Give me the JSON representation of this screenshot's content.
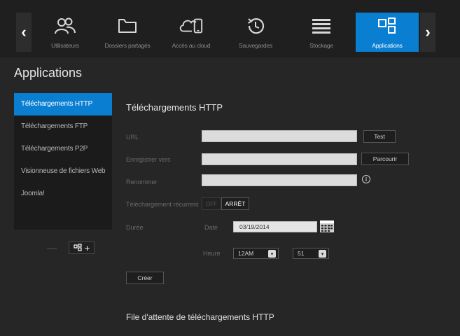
{
  "nav": {
    "items": [
      {
        "label": "Utilisateurs",
        "icon": "users-icon"
      },
      {
        "label": "Dossiers partagés",
        "icon": "folder-icon"
      },
      {
        "label": "Accès au cloud",
        "icon": "cloud-device-icon"
      },
      {
        "label": "Sauvegardes",
        "icon": "history-icon"
      },
      {
        "label": "Stockage",
        "icon": "storage-icon"
      },
      {
        "label": "Applications",
        "icon": "apps-icon",
        "active": true
      }
    ],
    "prev_arrow": "‹",
    "next_arrow": "›"
  },
  "page": {
    "title": "Applications"
  },
  "sidebar": {
    "items": [
      {
        "label": "Téléchargements HTTP",
        "active": true
      },
      {
        "label": "Téléchargements FTP"
      },
      {
        "label": "Téléchargements P2P"
      },
      {
        "label": "Visionneuse de fichiers Web"
      },
      {
        "label": "Joomla!"
      }
    ],
    "add_label": "+",
    "minus_label": "—"
  },
  "form": {
    "section_title": "Téléchargements HTTP",
    "url_label": "URL",
    "url_value": "",
    "test_button": "Test",
    "save_to_label": "Enregistrer vers",
    "save_to_value": "",
    "browse_button": "Parcourir",
    "rename_label": "Renommer",
    "rename_value": "",
    "recurring_label": "Téléchargement récurrent",
    "toggle_off_text": "OFF",
    "toggle_state": "ARRÊT",
    "schedule_label": "Durée",
    "date_label": "Date",
    "date_value": "03/19/2014",
    "time_label": "Heure",
    "hour_value": "12AM",
    "minute_value": "51",
    "create_button": "Créer"
  },
  "queue": {
    "title": "File d'attente de téléchargements HTTP"
  },
  "colors": {
    "accent": "#0a7fd2",
    "background": "#262626",
    "input": "#dcdcdc"
  }
}
